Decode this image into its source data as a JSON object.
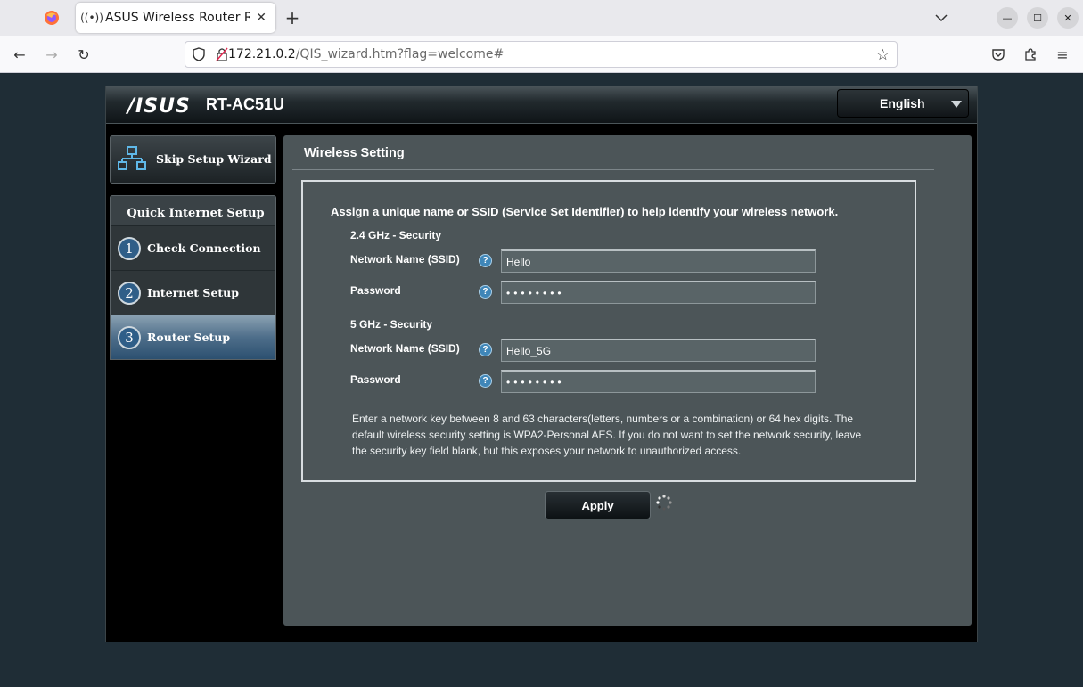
{
  "browser": {
    "tab_title": "ASUS Wireless Router RT",
    "url_host": "172.21.0.2",
    "url_path": "/QIS_wizard.htm?flag=welcome#"
  },
  "router": {
    "brand": "/ISUS",
    "model": "RT-AC51U",
    "language": "English"
  },
  "sidebar": {
    "skip_label": "Skip Setup Wizard",
    "qis_title": "Quick Internet Setup",
    "steps": [
      {
        "num": "1",
        "label": "Check Connection"
      },
      {
        "num": "2",
        "label": "Internet Setup"
      },
      {
        "num": "3",
        "label": "Router Setup"
      }
    ]
  },
  "main": {
    "title": "Wireless Setting",
    "intro": "Assign a unique name or SSID (Service Set Identifier) to help identify your wireless network.",
    "band24": {
      "section": "2.4 GHz - Security",
      "ssid_label": "Network Name (SSID)",
      "ssid_value": "Hello",
      "pw_label": "Password",
      "pw_value": "••••••••"
    },
    "band5": {
      "section": "5 GHz - Security",
      "ssid_label": "Network Name (SSID)",
      "ssid_value": "Hello_5G",
      "pw_label": "Password",
      "pw_value": "••••••••"
    },
    "note": "Enter a network key between 8 and 63 characters(letters, numbers or a combination) or 64 hex digits. The default wireless security setting is WPA2-Personal AES. If you do not want to set the network security, leave the security key field blank, but this exposes your network to unauthorized access.",
    "apply_label": "Apply",
    "help_glyph": "?"
  }
}
